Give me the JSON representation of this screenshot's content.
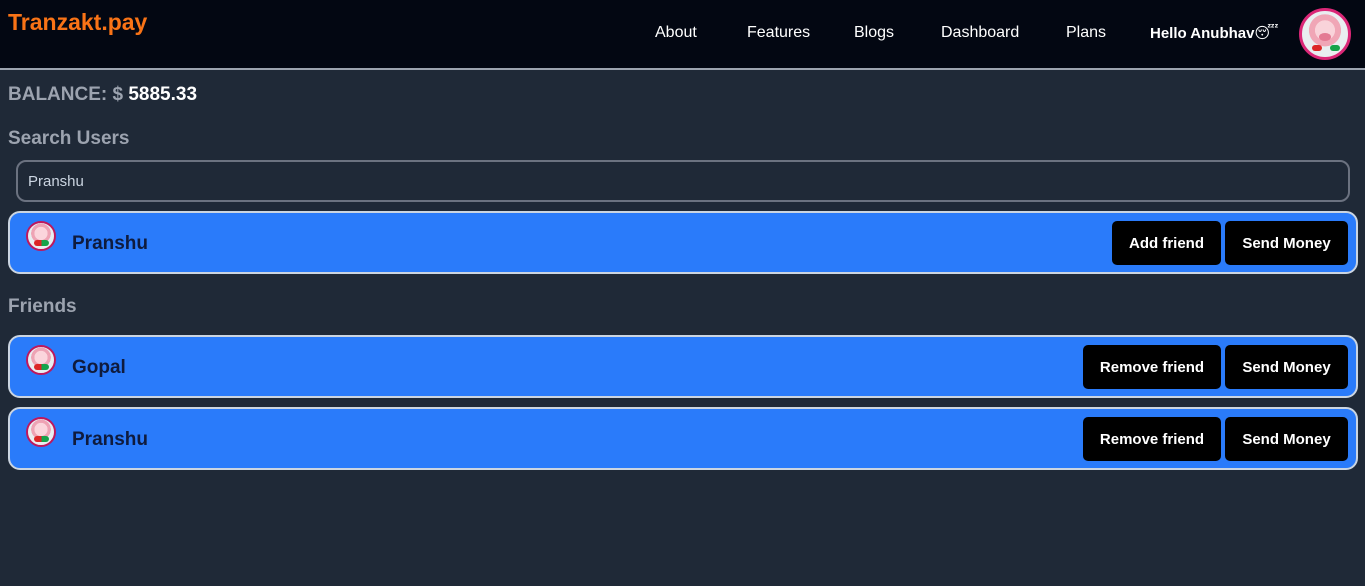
{
  "navbar": {
    "brand": "Tranzakt.pay",
    "links": [
      {
        "label": "About"
      },
      {
        "label": "Features"
      },
      {
        "label": "Blogs"
      },
      {
        "label": "Dashboard"
      },
      {
        "label": "Plans"
      }
    ],
    "greeting": "Hello Anubhav",
    "greeting_emoji": "😴"
  },
  "balance": {
    "label": "BALANCE: $",
    "amount": "5885.33"
  },
  "search": {
    "title": "Search Users",
    "value": "Pranshu"
  },
  "search_results": [
    {
      "name": "Pranshu",
      "primary_action": "Add friend",
      "secondary_action": "Send Money"
    }
  ],
  "friends": {
    "title": "Friends",
    "items": [
      {
        "name": "Gopal",
        "primary_action": "Remove friend",
        "secondary_action": "Send Money"
      },
      {
        "name": "Pranshu",
        "primary_action": "Remove friend",
        "secondary_action": "Send Money"
      }
    ]
  },
  "colors": {
    "brand": "#f97316",
    "card": "#2a7bfa",
    "background": "#1f2937",
    "navbar": "#030712"
  }
}
